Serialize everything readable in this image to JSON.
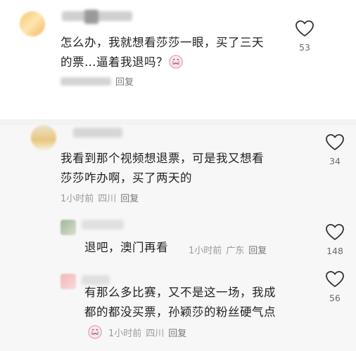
{
  "comments": [
    {
      "text_line1": "怎么办，我就想看莎莎一眼，买了三天",
      "text_line2": "的票…逼着我退吗？",
      "reply_label": "回复",
      "likes": "53"
    },
    {
      "text_line1": "我看到那个视频想退票，可是我又想看",
      "text_line2": "莎莎咋办啊，买了两天的",
      "time": "1小时前",
      "location": "四川",
      "reply_label": "回复",
      "likes": "34"
    }
  ],
  "replies": [
    {
      "text": "退吧，澳门再看",
      "time": "1小时前",
      "location": "广东",
      "reply_label": "回复",
      "likes": "148"
    },
    {
      "text_line1": "有那么多比赛，又不是这一场，我成",
      "text_line2": "都的都没买票，孙颖莎的粉丝硬气点",
      "time": "1小时前",
      "location": "四川",
      "reply_label": "回复",
      "likes": "56"
    }
  ],
  "icons": {
    "like": "heart-outline-icon",
    "emoji": "crying-face-icon"
  },
  "colors": {
    "text": "#1f1f1f",
    "meta": "#9a9a9a",
    "heart_stroke": "#333333"
  }
}
